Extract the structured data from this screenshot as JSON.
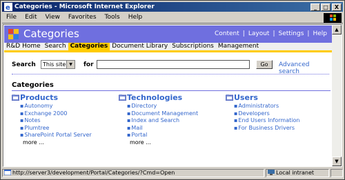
{
  "window": {
    "title": "Categories - Microsoft Internet Explorer",
    "buttons": [
      "_",
      "□",
      "X"
    ]
  },
  "menubar": [
    "File",
    "Edit",
    "View",
    "Favorites",
    "Tools",
    "Help"
  ],
  "banner": {
    "title": "Categories",
    "links": [
      "Content",
      "Layout",
      "Settings",
      "Help"
    ]
  },
  "tabs": {
    "items": [
      "R&D Home",
      "Search",
      "Categories",
      "Document Library",
      "Subscriptions",
      "Management"
    ],
    "active": "Categories"
  },
  "search": {
    "label": "Search",
    "scope": "This site",
    "for_label": "for",
    "query": "",
    "go": "Go",
    "advanced": "Advanced search"
  },
  "categories": {
    "heading": "Categories",
    "columns": [
      {
        "title": "Products",
        "items": [
          "Autonomy",
          "Exchange 2000",
          "Notes",
          "Plumtree",
          "SharePoint Portal Server"
        ],
        "more": "more ..."
      },
      {
        "title": "Technologies",
        "items": [
          "Directory",
          "Document Management",
          "Index and Search",
          "Mail",
          "Portal"
        ],
        "more": "more ..."
      },
      {
        "title": "Users",
        "items": [
          "Administrators",
          "Developers",
          "End Users Information",
          "For Business Drivers"
        ],
        "more": ""
      }
    ]
  },
  "statusbar": {
    "url": "http://server3/development/Portal/Categories/?Cmd=Open",
    "zone": "Local intranet"
  },
  "colors": {
    "banner": "#6f6fdf",
    "tab_active": "#ffcc00",
    "link": "#3366cc"
  }
}
